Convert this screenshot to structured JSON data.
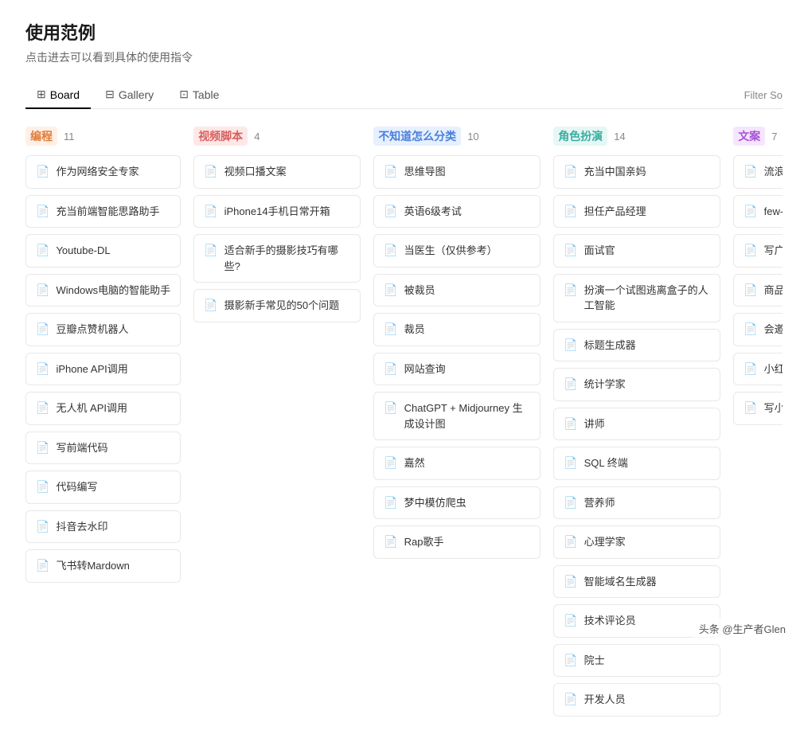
{
  "page": {
    "title": "使用范例",
    "subtitle": "点击进去可以看到具体的使用指令"
  },
  "tabs": [
    {
      "id": "board",
      "label": "Board",
      "icon": "⊞",
      "active": true
    },
    {
      "id": "gallery",
      "label": "Gallery",
      "icon": "⊟",
      "active": false
    },
    {
      "id": "table",
      "label": "Table",
      "icon": "⊡",
      "active": false
    }
  ],
  "filter_label": "Filter  So",
  "columns": [
    {
      "id": "programming",
      "label": "编程",
      "count": 11,
      "labelClass": "label-orange",
      "cards": [
        "作为网络安全专家",
        "充当前端智能思路助手",
        "Youtube-DL",
        "Windows电脑的智能助手",
        "豆瓣点赞机器人",
        "iPhone API调用",
        "无人机 API调用",
        "写前端代码",
        "代码编写",
        "抖音去水印",
        "飞书转Mardown"
      ]
    },
    {
      "id": "video-script",
      "label": "视频脚本",
      "count": 4,
      "labelClass": "label-pink",
      "cards": [
        "视频口播文案",
        "iPhone14手机日常开箱",
        "适合新手的摄影技巧有哪些?",
        "摄影新手常见的50个问题"
      ]
    },
    {
      "id": "uncategorized",
      "label": "不知道怎么分类",
      "count": 10,
      "labelClass": "label-blue",
      "cards": [
        "思维导图",
        "英语6级考试",
        "当医生（仅供参考）",
        "被裁员",
        "裁员",
        "网站查询",
        "ChatGPT + Midjourney 生成设计图",
        "嘉然",
        "梦中模仿爬虫",
        "Rap歌手"
      ]
    },
    {
      "id": "roleplay",
      "label": "角色扮演",
      "count": 14,
      "labelClass": "label-teal",
      "cards": [
        "充当中国亲妈",
        "担任产品经理",
        "面试官",
        "扮演一个试图逃离盒子的人工智能",
        "标题生成器",
        "统计学家",
        "讲师",
        "SQL 终端",
        "营养师",
        "心理学家",
        "智能域名生成器",
        "技术评论员",
        "院士",
        "开发人员"
      ]
    },
    {
      "id": "copywriting",
      "label": "文案",
      "count": 7,
      "labelClass": "label-purple",
      "cards": [
        "流浪地球好评",
        "few-shot文本固定模式转写",
        "写广告创意",
        "商品评价",
        "会邀",
        "小红书文案",
        "写小说"
      ]
    }
  ],
  "watermark": "头条 @生产者Glen"
}
